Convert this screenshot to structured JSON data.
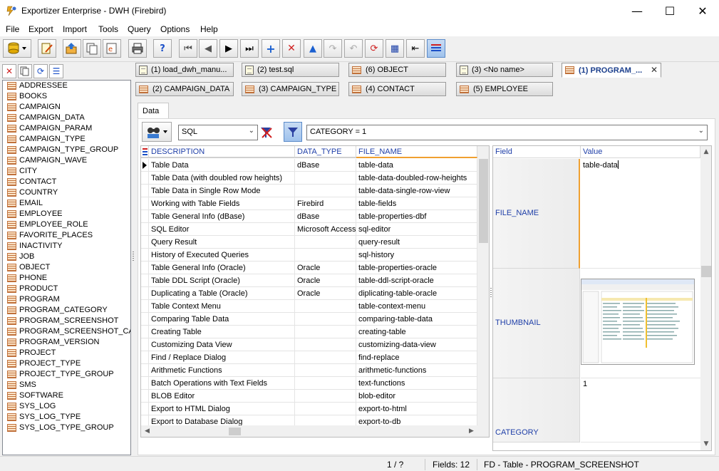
{
  "window": {
    "title": "Exportizer Enterprise - DWH (Firebird)",
    "minimize_glyph": "—",
    "maximize_glyph": "☐",
    "close_glyph": "✕"
  },
  "menu": [
    "File",
    "Export",
    "Import",
    "Tools",
    "Query",
    "Options",
    "Help"
  ],
  "tables": [
    "ADDRESSEE",
    "BOOKS",
    "CAMPAIGN",
    "CAMPAIGN_DATA",
    "CAMPAIGN_PARAM",
    "CAMPAIGN_TYPE",
    "CAMPAIGN_TYPE_GROUP",
    "CAMPAIGN_WAVE",
    "CITY",
    "CONTACT",
    "COUNTRY",
    "EMAIL",
    "EMPLOYEE",
    "EMPLOYEE_ROLE",
    "FAVORITE_PLACES",
    "INACTIVITY",
    "JOB",
    "OBJECT",
    "PHONE",
    "PRODUCT",
    "PROGRAM",
    "PROGRAM_CATEGORY",
    "PROGRAM_SCREENSHOT",
    "PROGRAM_SCREENSHOT_CATE",
    "PROGRAM_VERSION",
    "PROJECT",
    "PROJECT_TYPE",
    "PROJECT_TYPE_GROUP",
    "SMS",
    "SOFTWARE",
    "SYS_LOG",
    "SYS_LOG_TYPE",
    "SYS_LOG_TYPE_GROUP"
  ],
  "tabs_row1": [
    {
      "label": "(1) load_dwh_manu...",
      "kind": "sql"
    },
    {
      "label": "(2) test.sql",
      "kind": "sql"
    },
    {
      "label": "(6) OBJECT",
      "kind": "table"
    },
    {
      "label": "(3) <No name>",
      "kind": "sql"
    },
    {
      "label": "(1) PROGRAM_...",
      "kind": "table",
      "active": true,
      "close": "✕"
    }
  ],
  "tabs_row2": [
    {
      "label": "(2) CAMPAIGN_DATA",
      "kind": "table"
    },
    {
      "label": "(3) CAMPAIGN_TYPE",
      "kind": "table"
    },
    {
      "label": "(4) CONTACT",
      "kind": "table"
    },
    {
      "label": "(5) EMPLOYEE",
      "kind": "table"
    }
  ],
  "subtab": "Data",
  "filter": {
    "mode": "SQL",
    "expression": "CATEGORY = 1"
  },
  "grid": {
    "columns": [
      "DESCRIPTION",
      "DATA_TYPE",
      "FILE_NAME"
    ],
    "rows": [
      [
        "Table Data",
        "dBase",
        "table-data"
      ],
      [
        "Table Data (with doubled row heights)",
        "",
        "table-data-doubled-row-heights"
      ],
      [
        "Table Data in Single Row Mode",
        "",
        "table-data-single-row-view"
      ],
      [
        "Working with Table Fields",
        "Firebird",
        "table-fields"
      ],
      [
        "Table General Info (dBase)",
        "dBase",
        "table-properties-dbf"
      ],
      [
        "SQL Editor",
        "Microsoft Access",
        "sql-editor"
      ],
      [
        "Query Result",
        "",
        "query-result"
      ],
      [
        "History of Executed Queries",
        "",
        "sql-history"
      ],
      [
        "Table General Info (Oracle)",
        "Oracle",
        "table-properties-oracle"
      ],
      [
        "Table DDL Script (Oracle)",
        "Oracle",
        "table-ddl-script-oracle"
      ],
      [
        "Duplicating a Table (Oracle)",
        "Oracle",
        "diplicating-table-oracle"
      ],
      [
        "Table Context Menu",
        "",
        "table-context-menu"
      ],
      [
        "Comparing Table Data",
        "",
        "comparing-table-data"
      ],
      [
        "Creating Table",
        "",
        "creating-table"
      ],
      [
        "Customizing Data View",
        "",
        "customizing-data-view"
      ],
      [
        "Find / Replace Dialog",
        "",
        "find-replace"
      ],
      [
        "Arithmetic Functions",
        "",
        "arithmetic-functions"
      ],
      [
        "Batch Operations with Text Fields",
        "",
        "text-functions"
      ],
      [
        "BLOB Editor",
        "",
        "blob-editor"
      ],
      [
        "Export to HTML Dialog",
        "",
        "export-to-html"
      ],
      [
        "Export to Database Dialog",
        "",
        "export-to-db"
      ]
    ]
  },
  "detail": {
    "field_header": "Field",
    "value_header": "Value",
    "rows": [
      {
        "field": "FILE_NAME",
        "value": "table-data"
      },
      {
        "field": "THUMBNAIL",
        "value": ""
      },
      {
        "field": "CATEGORY",
        "value": "1"
      }
    ]
  },
  "status": {
    "position": "1 / ?",
    "fields": "Fields: 12",
    "info": "FD - Table - PROGRAM_SCREENSHOT"
  }
}
